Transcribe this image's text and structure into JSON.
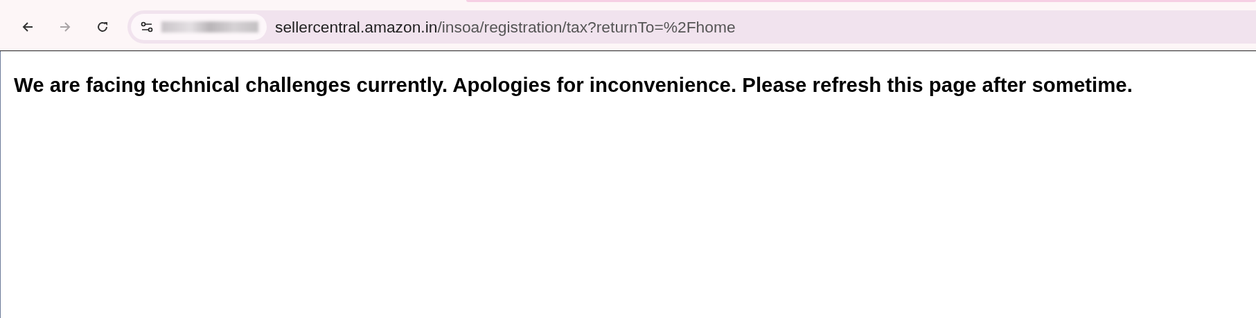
{
  "toolbar": {
    "back_disabled": false,
    "forward_disabled": true
  },
  "address_bar": {
    "domain": "sellercentral.amazon.in",
    "path": "/insoa/registration/tax?returnTo=%2Fhome"
  },
  "page": {
    "message": "We are facing technical challenges currently. Apologies for inconvenience. Please refresh this page after sometime."
  }
}
